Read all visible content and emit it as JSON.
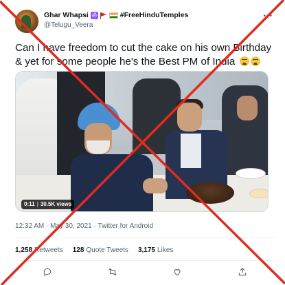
{
  "tweet": {
    "author": {
      "display_name": "Ghar Whapsi",
      "om_symbol": "ॐ",
      "hashtag": "#FreeHinduTemples",
      "handle": "@Telugu_Veera"
    },
    "more_icon": "more-options-icon",
    "text": "Can I have freedom to cut the cake on his own Birthday & yet for some people he's the Best PM of India",
    "emojis": [
      "tired-face-emoji",
      "tired-face-emoji"
    ],
    "media": {
      "type": "video",
      "duration": "0:11",
      "views": "30.5K views"
    },
    "timestamp": "12:32 AM · May 30, 2021 · Twitter for Android",
    "stats": {
      "retweets_count": "1,258",
      "retweets_label": "Retweets",
      "quotes_count": "128",
      "quotes_label": "Quote Tweets",
      "likes_count": "3,175",
      "likes_label": "Likes"
    },
    "actions": [
      "reply-icon",
      "retweet-icon",
      "like-icon",
      "share-icon"
    ]
  },
  "overlay": {
    "mark": "red-cross",
    "color": "#e02b20"
  }
}
